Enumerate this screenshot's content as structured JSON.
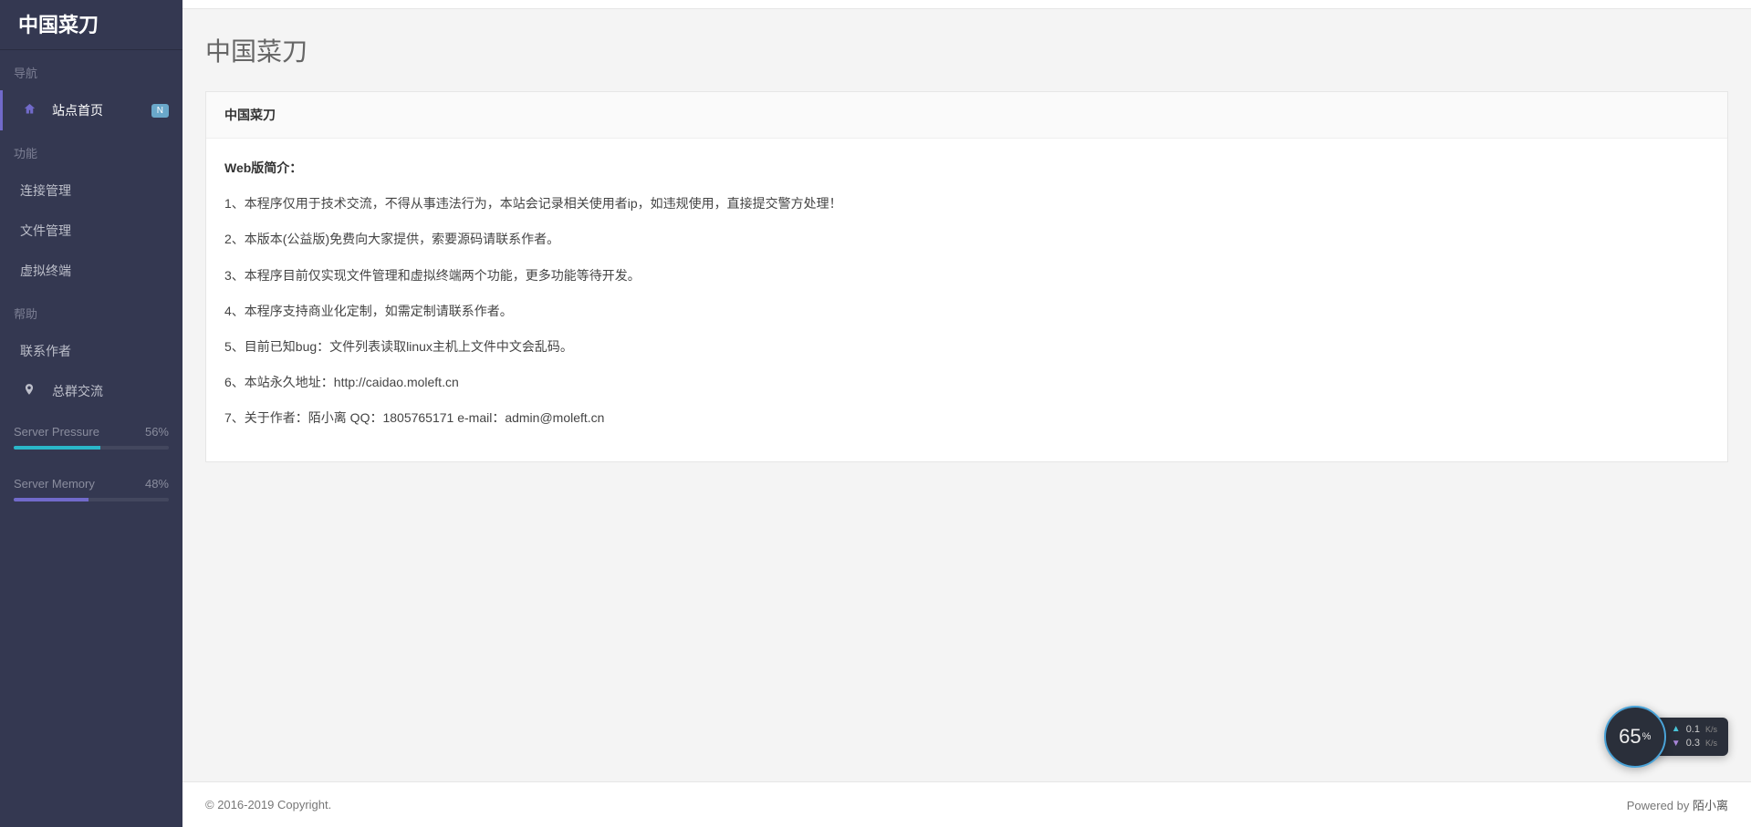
{
  "sidebar": {
    "logo": "中国菜刀",
    "groups": [
      {
        "title": "导航",
        "items": [
          {
            "label": "站点首页",
            "icon": "home",
            "active": true,
            "badge": "N"
          }
        ]
      },
      {
        "title": "功能",
        "items": [
          {
            "label": "连接管理",
            "icon": ""
          },
          {
            "label": "文件管理",
            "icon": ""
          },
          {
            "label": "虚拟终端",
            "icon": ""
          }
        ]
      },
      {
        "title": "帮助",
        "items": [
          {
            "label": "联系作者",
            "icon": ""
          },
          {
            "label": "总群交流",
            "icon": "pin"
          }
        ]
      }
    ],
    "metrics": [
      {
        "label": "Server Pressure",
        "value": "56%",
        "pct": 56,
        "color": "#2ab7c9"
      },
      {
        "label": "Server Memory",
        "value": "48%",
        "pct": 48,
        "color": "#716aca"
      }
    ]
  },
  "page": {
    "title": "中国菜刀",
    "card_title": "中国菜刀",
    "intro_heading": "Web版简介：",
    "paragraphs": [
      "1、本程序仅用于技术交流，不得从事违法行为，本站会记录相关使用者ip，如违规使用，直接提交警方处理！",
      "2、本版本(公益版)免费向大家提供，索要源码请联系作者。",
      "3、本程序目前仅实现文件管理和虚拟终端两个功能，更多功能等待开发。",
      "4、本程序支持商业化定制，如需定制请联系作者。",
      "5、目前已知bug：文件列表读取linux主机上文件中文会乱码。",
      "6、本站永久地址：http://caidao.moleft.cn",
      "7、关于作者：陌小离 QQ：1805765171 e-mail：admin@moleft.cn"
    ]
  },
  "footer": {
    "copyright": "© 2016-2019 Copyright.",
    "powered_prefix": "Powered by ",
    "powered_link": "陌小离"
  },
  "widget": {
    "gauge_value": "65",
    "gauge_unit": "%",
    "up": "0.1",
    "down": "0.3",
    "unit": "K/s"
  }
}
